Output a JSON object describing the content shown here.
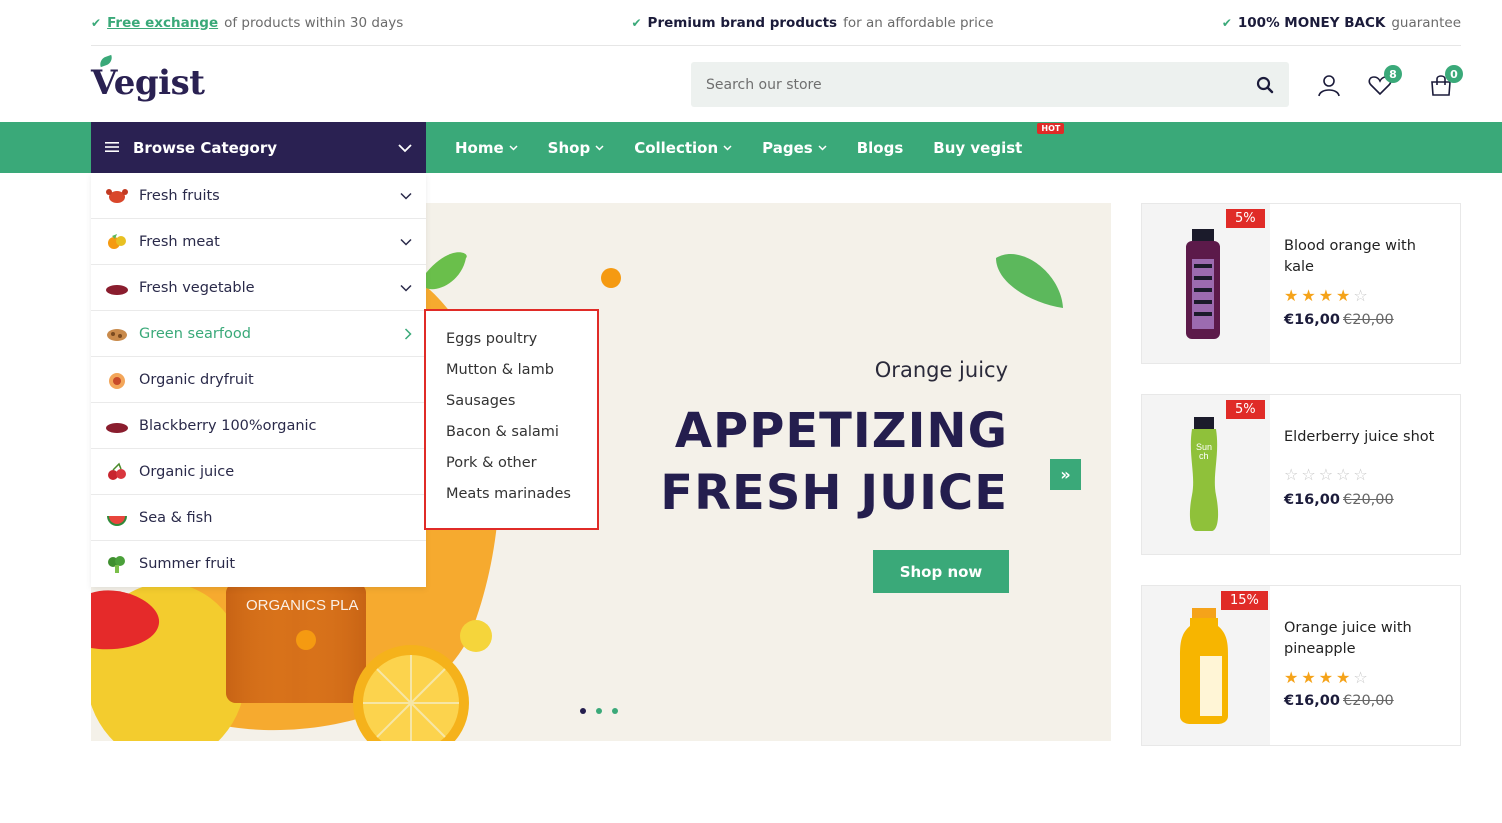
{
  "topbar": {
    "item1_link": "Free exchange",
    "item1_text": "of products within 30 days",
    "item2_bold": "Premium brand products",
    "item2_text": "for an affordable price",
    "item3_bold": "100% MONEY BACK",
    "item3_text": "guarantee"
  },
  "header": {
    "logo": "Vegist",
    "search_placeholder": "Search our store",
    "wishlist_count": "8",
    "cart_count": "0"
  },
  "nav": {
    "browse_label": "Browse Category",
    "items": [
      {
        "label": "Home"
      },
      {
        "label": "Shop"
      },
      {
        "label": "Collection"
      },
      {
        "label": "Pages"
      },
      {
        "label": "Blogs"
      },
      {
        "label": "Buy vegist"
      }
    ],
    "hot_badge": "HOT"
  },
  "categories": [
    {
      "label": "Fresh fruits"
    },
    {
      "label": "Fresh meat"
    },
    {
      "label": "Fresh vegetable"
    },
    {
      "label": "Green searfood"
    },
    {
      "label": "Organic dryfruit"
    },
    {
      "label": "Blackberry 100%organic"
    },
    {
      "label": "Organic juice"
    },
    {
      "label": "Sea & fish"
    },
    {
      "label": "Summer fruit"
    }
  ],
  "submenu": [
    "Eggs poultry",
    "Mutton & lamb",
    "Sausages",
    "Bacon & salami",
    "Pork & other",
    "Meats marinades"
  ],
  "hero": {
    "subtitle": "Orange juicy",
    "title_line1": "APPETIZING",
    "title_line2": "FRESH JUICE",
    "button": "Shop now",
    "jar_label": "ORGANICS PLA"
  },
  "products": [
    {
      "name": "Blood orange with kale",
      "discount": "5%",
      "price": "€16,00",
      "old_price": "€20,00",
      "rating": 4
    },
    {
      "name": "Elderberry juice shot",
      "discount": "5%",
      "price": "€16,00",
      "old_price": "€20,00",
      "rating": 0
    },
    {
      "name": "Orange juice with pineapple",
      "discount": "15%",
      "price": "€16,00",
      "old_price": "€20,00",
      "rating": 4
    }
  ],
  "colors": {
    "accent": "#3aa979",
    "navy": "#2a2152",
    "sale": "#e02b27"
  }
}
